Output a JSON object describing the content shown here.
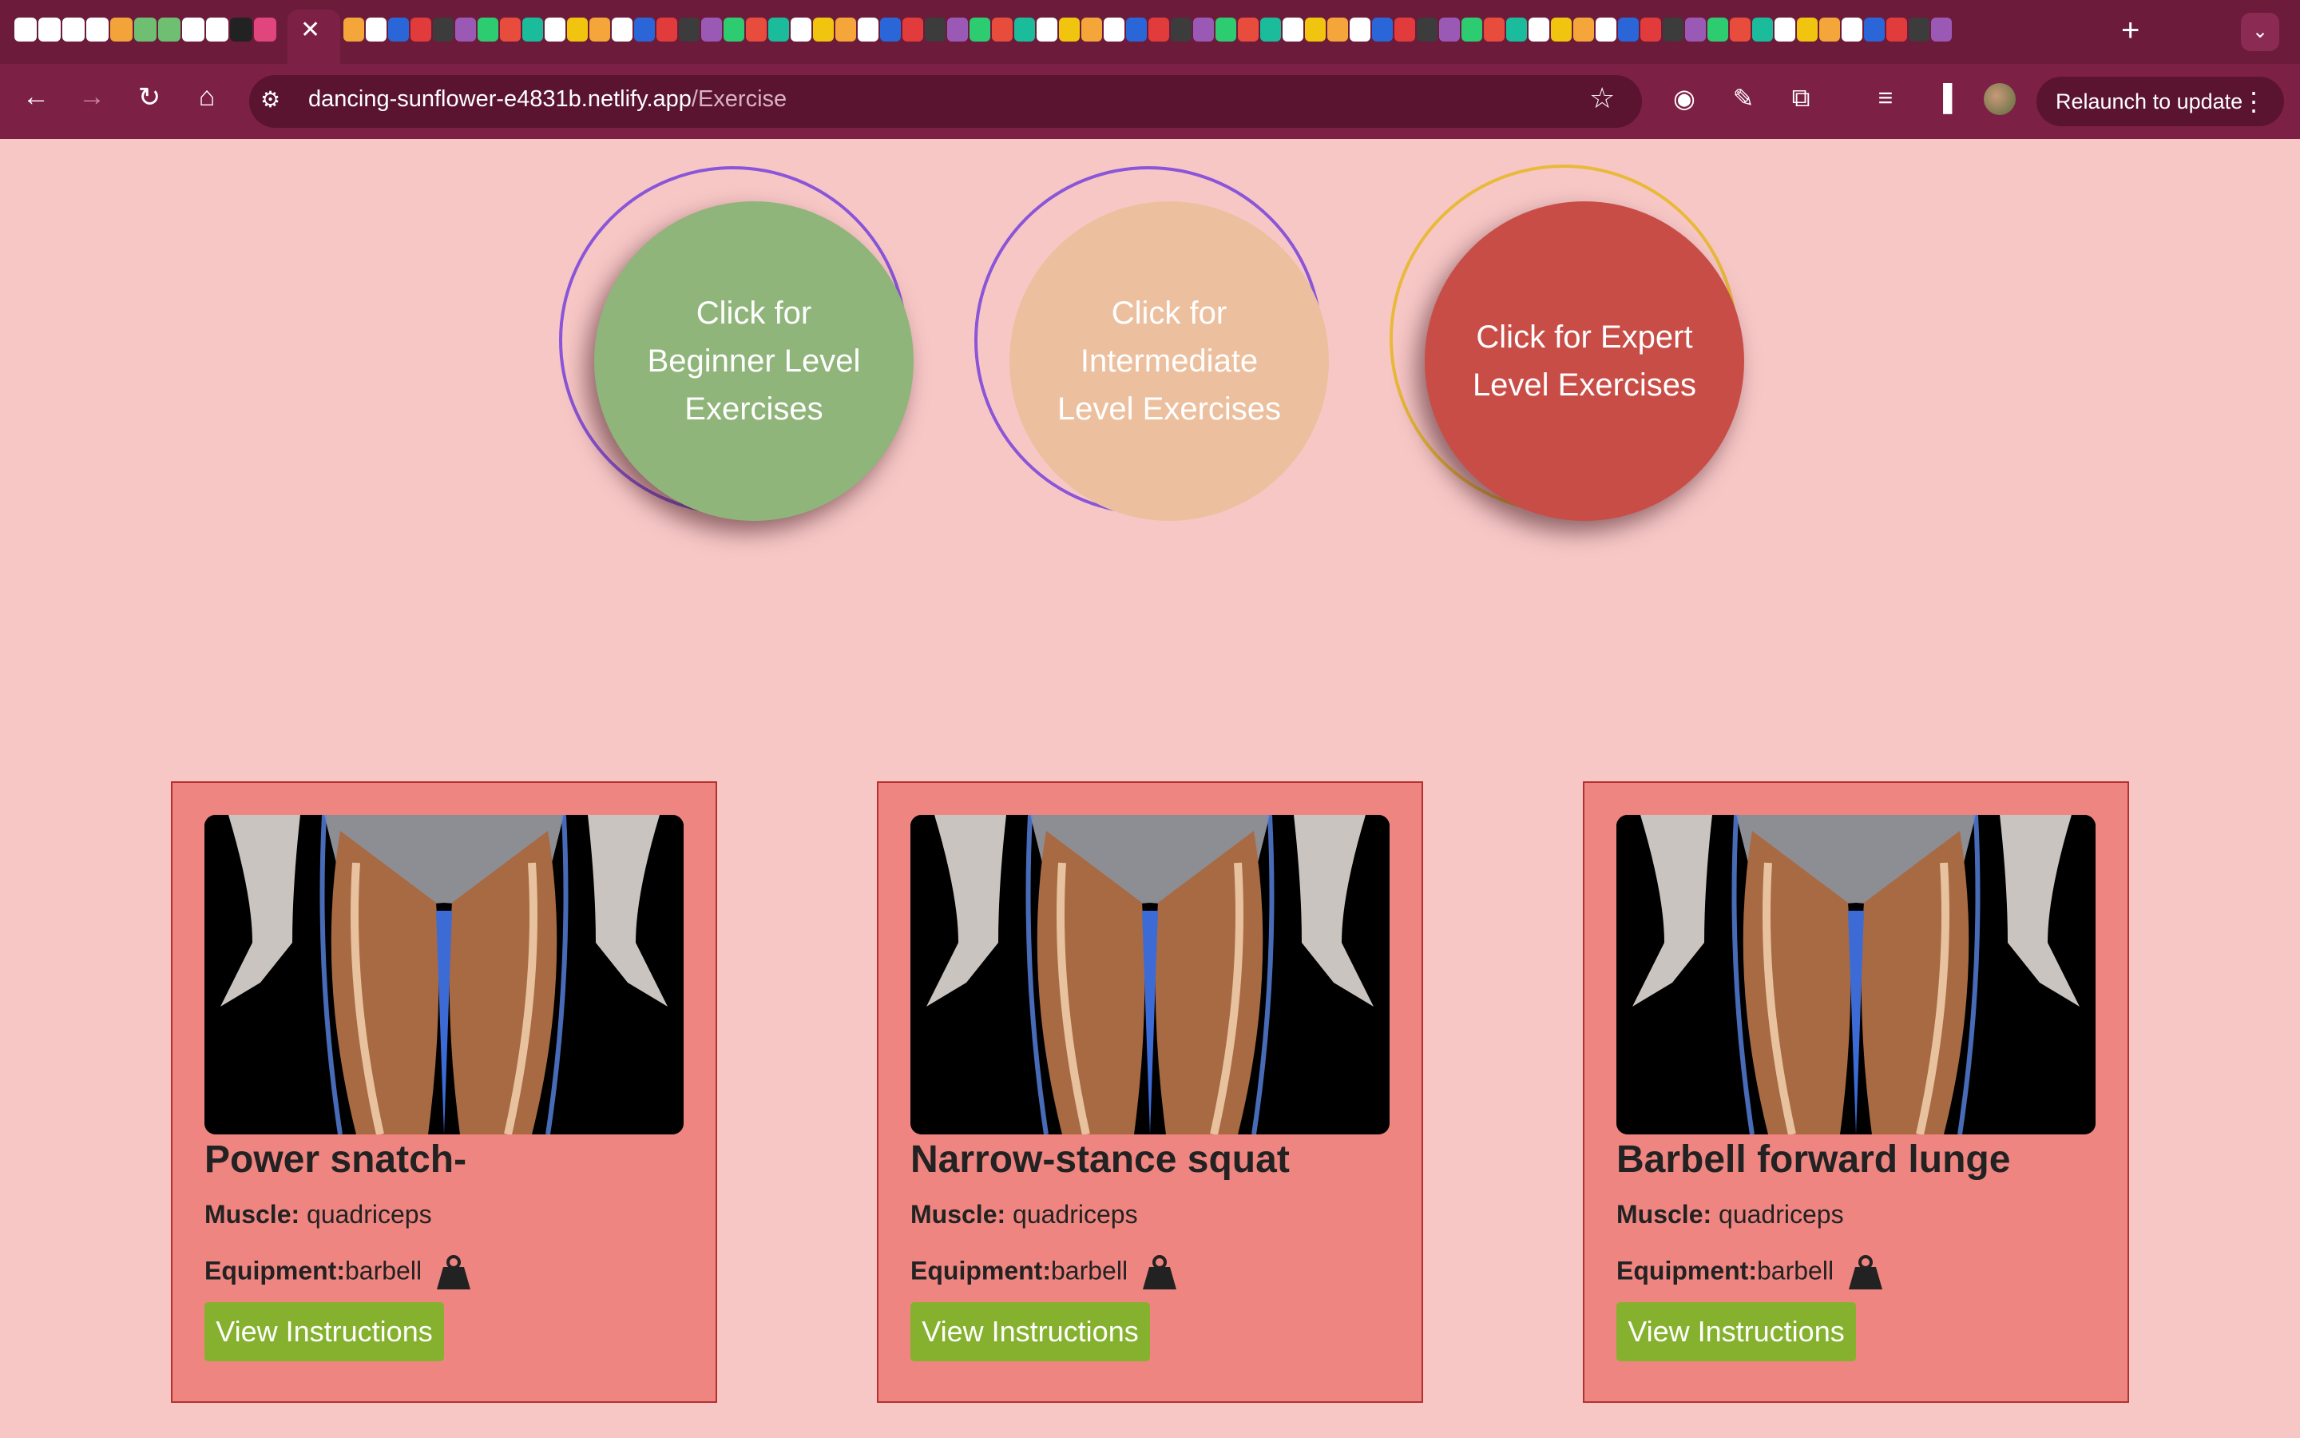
{
  "browser": {
    "url_host": "dancing-sunflower-e4831b.netlify.app",
    "url_path": "/Exercise",
    "relaunch_label": "Relaunch to update",
    "close_glyph": "✕",
    "new_tab_glyph": "+",
    "tab_search_glyph": "⌄",
    "back_glyph": "←",
    "forward_glyph": "→",
    "reload_glyph": "↻",
    "home_glyph": "⌂",
    "star_glyph": "☆",
    "menu_glyph": "⋮",
    "tab_icons": [
      "github-icon",
      "github-icon",
      "github-icon",
      "github-icon",
      "fs-icon",
      "w-icon",
      "w-icon",
      "github-icon",
      "github-icon",
      "dev-icon",
      "slack-icon"
    ]
  },
  "levels": {
    "beginner": {
      "label": "Click for Beginner Level Exercises",
      "color": "#8fb57a"
    },
    "intermediate": {
      "label": "Click for Intermediate Level Exercises",
      "color": "#ecc09f"
    },
    "expert": {
      "label": "Click for Expert Level Exercises",
      "color": "#c94d47"
    }
  },
  "cards": [
    {
      "title": "Power snatch-",
      "muscle_label": "Muscle:",
      "muscle": "quadriceps",
      "equipment_label": "Equipment:",
      "equipment": "barbell",
      "button": "View Instructions"
    },
    {
      "title": "Narrow-stance squat",
      "muscle_label": "Muscle:",
      "muscle": "quadriceps",
      "equipment_label": "Equipment:",
      "equipment": "barbell",
      "button": "View Instructions"
    },
    {
      "title": "Barbell forward lunge",
      "muscle_label": "Muscle:",
      "muscle": "quadriceps",
      "equipment_label": "Equipment:",
      "equipment": "barbell",
      "button": "View Instructions"
    }
  ],
  "colors": {
    "page_bg": "#f7c7c6",
    "card_bg": "#ef8580",
    "button_bg": "#86b12f",
    "chrome_dark": "#6c1b3b"
  }
}
